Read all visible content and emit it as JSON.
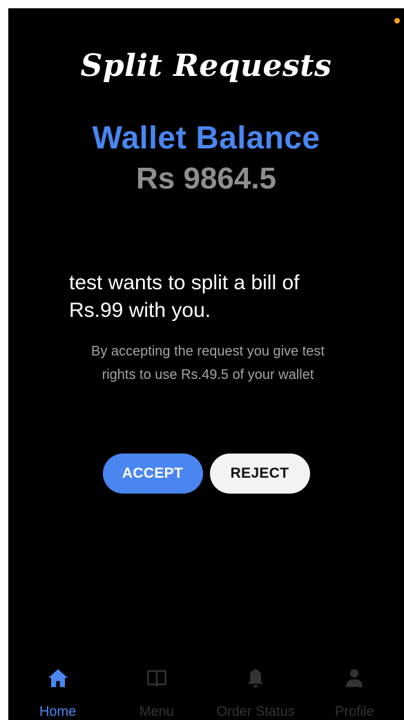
{
  "header": {
    "title": "Split Requests"
  },
  "wallet": {
    "label": "Wallet Balance",
    "amount": "Rs 9864.5"
  },
  "request": {
    "message": "test wants to split a bill of Rs.99 with you.",
    "note": "By accepting the request you give test rights to use Rs.49.5 of your wallet"
  },
  "actions": {
    "accept_label": "ACCEPT",
    "reject_label": "REJECT"
  },
  "nav": {
    "items": [
      {
        "label": "Home",
        "icon": "home-icon",
        "active": true
      },
      {
        "label": "Menu",
        "icon": "book-icon",
        "active": false
      },
      {
        "label": "Order Status",
        "icon": "bell-icon",
        "active": false
      },
      {
        "label": "Profile",
        "icon": "person-icon",
        "active": false
      }
    ]
  },
  "colors": {
    "accent": "#4a86f0",
    "background": "#000000",
    "muted_text": "#8e8e8e",
    "inactive_nav": "#333333"
  }
}
